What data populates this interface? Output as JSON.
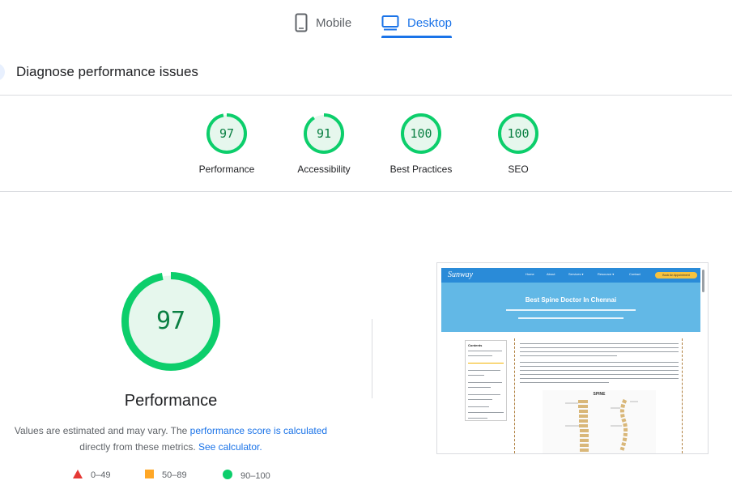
{
  "tabs": [
    {
      "label": "Mobile",
      "icon": "smartphone-icon",
      "active": false
    },
    {
      "label": "Desktop",
      "icon": "desktop-icon",
      "active": true
    }
  ],
  "diagnose": {
    "title": "Diagnose performance issues"
  },
  "scores": [
    {
      "label": "Performance",
      "value": "97",
      "score": 97
    },
    {
      "label": "Accessibility",
      "value": "91",
      "score": 91
    },
    {
      "label": "Best Practices",
      "value": "100",
      "score": 100
    },
    {
      "label": "SEO",
      "value": "100",
      "score": 100
    }
  ],
  "main_gauge": {
    "value": "97",
    "score": 97,
    "title": "Performance",
    "note_prefix": "Values are estimated and may vary. The ",
    "note_link1": "performance score is calculated",
    "note_middle": "directly from these metrics. ",
    "note_link2": "See calculator."
  },
  "legend": [
    {
      "range": "0–49",
      "shape": "triangle",
      "color": "#e53935"
    },
    {
      "range": "50–89",
      "shape": "square",
      "color": "#ffa726"
    },
    {
      "range": "90–100",
      "shape": "circle",
      "color": "#0cce6b"
    }
  ],
  "colors": {
    "accent": "#1a73e8",
    "pass": "#0cce6b",
    "pass_text": "#0b8043",
    "pass_fill": "#e6f7ed"
  },
  "thumbnail": {
    "logo": "Sunway",
    "menu": [
      "Home",
      "About",
      "Services ▾",
      "Resource ▾",
      "Contact"
    ],
    "cta": "Book An Appointment",
    "hero_title": "Best Spine Doctor In Chennai",
    "toc_title": "Contents",
    "spine_title": "SPINE"
  }
}
